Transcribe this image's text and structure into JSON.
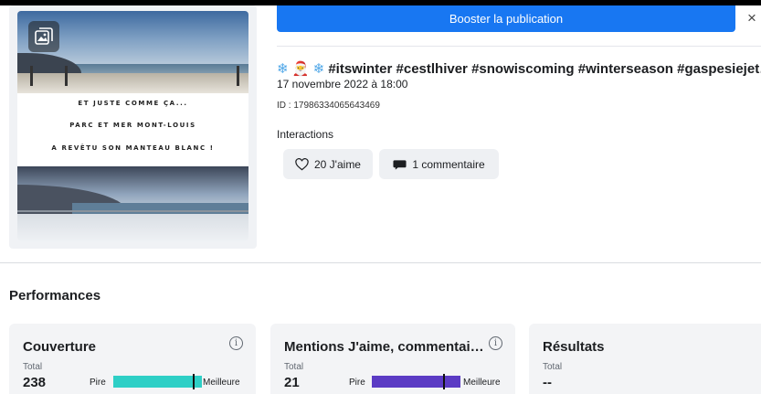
{
  "post": {
    "boost_label": "Booster la publication",
    "close_glyph": "×",
    "hashtags": "#itswinter #cestlhiver #snowiscoming #winterseason #gaspesiejet…",
    "emoji_prefix": "❄ 🎅 ❄",
    "date": "17 novembre 2022 à 18:00",
    "id": "ID : 17986334065643469",
    "interactions_label": "Interactions",
    "likes": "20 J'aime",
    "comments": "1 commentaire",
    "thumbnail": {
      "line1": "ET JUSTE COMME ÇA...",
      "line2": "PARC ET MER MONT-LOUIS",
      "line3": "A REVÊTU SON MANTEAU BLANC !",
      "badge_icon": "photo-carousel-icon"
    }
  },
  "performance": {
    "title": "Performances",
    "cards": [
      {
        "title": "Couverture",
        "total_label": "Total",
        "value": "238",
        "worst": "Pire",
        "best": "Meilleure",
        "bar_color": "#2ecfc6",
        "level": 0.9
      },
      {
        "title": "Mentions J'aime, commentai…",
        "total_label": "Total",
        "value": "21",
        "worst": "Pire",
        "best": "Meilleure",
        "bar_color": "#5b3bc4",
        "level": 0.8
      },
      {
        "title": "Résultats",
        "total_label": "Total",
        "value": "--"
      }
    ]
  },
  "colors": {
    "accent": "#1877f2",
    "card_bg": "#f3f4f6",
    "chip_bg": "#eef0f3"
  }
}
